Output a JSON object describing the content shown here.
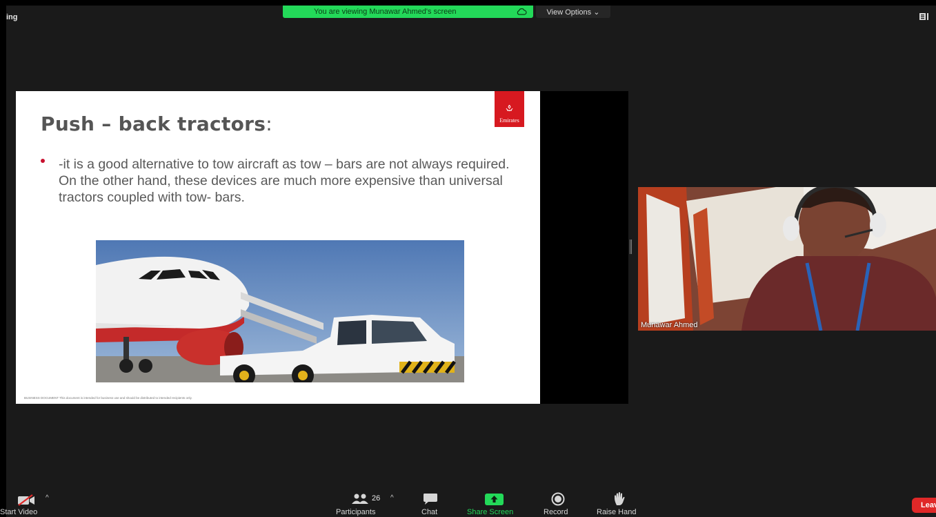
{
  "meeting": {
    "title_fragment": "ing"
  },
  "banner": {
    "text": "You are viewing Munawar Ahmed's screen"
  },
  "view_options": {
    "label": "View Options ⌄"
  },
  "slide": {
    "title": "Push – back tractors",
    "title_suffix": ":",
    "logo_text": "Emirates",
    "bullet": "-it is a good alternative to tow aircraft as tow – bars are not always required. On the other hand, these devices are much more expensive than universal tractors coupled with tow- bars.",
    "footer": "BUSINESS DOCUMENT This document is intended for business use and should be distributed to intended recipients only."
  },
  "participant": {
    "name": "Munawar Ahmed"
  },
  "toolbar": {
    "start_video": "Start Video",
    "participants": "Participants",
    "participants_count": "26",
    "chat": "Chat",
    "share_screen": "Share Screen",
    "record": "Record",
    "raise_hand": "Raise Hand",
    "leave": "Leave"
  },
  "colors": {
    "banner": "#23d959",
    "share_screen_icon": "#23d959",
    "leave": "#e02828",
    "emirates_red": "#d71920",
    "muted_video_slash": "#e02828"
  },
  "icons": [
    "video-muted-icon",
    "participants-icon",
    "chat-icon",
    "share-screen-icon",
    "record-icon",
    "raise-hand-icon",
    "cloud-icon",
    "layout-icon"
  ]
}
